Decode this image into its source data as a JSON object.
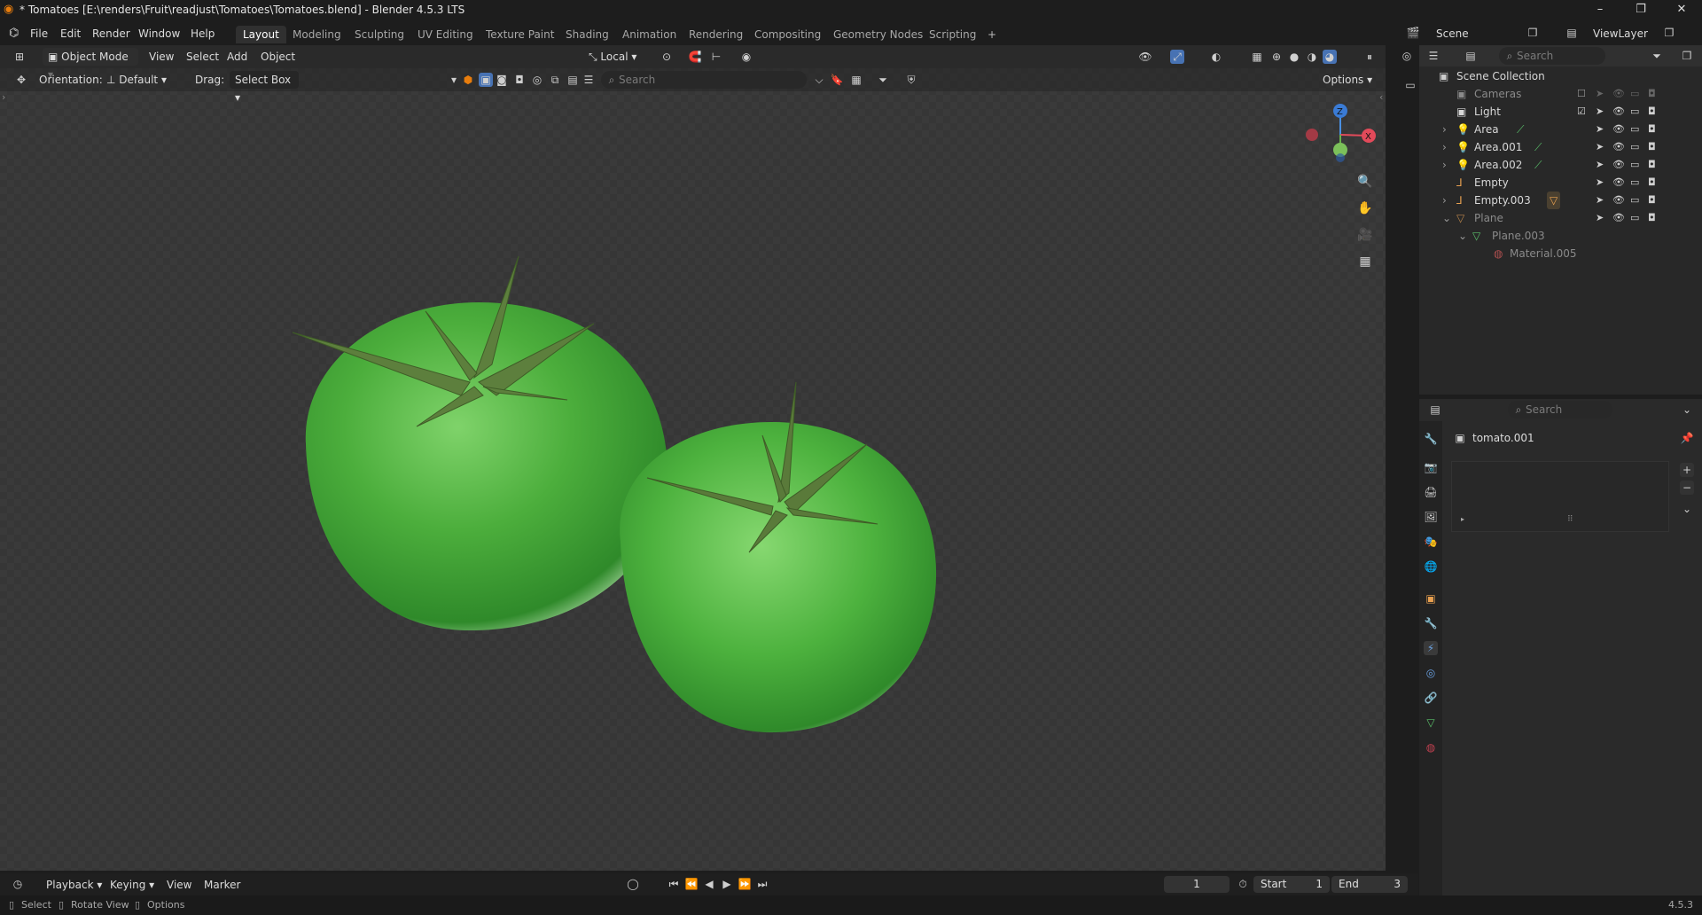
{
  "window": {
    "title": "* Tomatoes [E:\\renders\\Fruit\\readjust\\Tomatoes\\Tomatoes.blend] - Blender 4.5.3 LTS",
    "minimize": "–",
    "maximize": "❐",
    "close": "✕"
  },
  "menu": [
    "File",
    "Edit",
    "Render",
    "Window",
    "Help"
  ],
  "workspaces": [
    "Layout",
    "Modeling",
    "Sculpting",
    "UV Editing",
    "Texture Paint",
    "Shading",
    "Animation",
    "Rendering",
    "Compositing",
    "Geometry Nodes",
    "Scripting"
  ],
  "active_workspace": "Layout",
  "add_workspace": "+",
  "scene": {
    "label": "Scene",
    "viewlayer": "ViewLayer"
  },
  "viewport_header": {
    "mode": "Object Mode",
    "menus": [
      "View",
      "Select",
      "Add",
      "Object"
    ],
    "transform_space": "Local",
    "options": "Options"
  },
  "tool_settings": {
    "orientation_label": "Orientation:",
    "orientation_value": "Default",
    "drag_label": "Drag:",
    "drag_value": "Select Box",
    "search_placeholder": "Search"
  },
  "gizmo": {
    "z": "Z",
    "x": "X",
    "y": "Y"
  },
  "outliner": {
    "search_placeholder": "Search",
    "root": "Scene Collection",
    "rows": [
      {
        "name": "Cameras",
        "dim": true
      },
      {
        "name": "Light",
        "dim": false
      },
      {
        "name": "Area",
        "dim": false
      },
      {
        "name": "Area.001",
        "dim": false
      },
      {
        "name": "Area.002",
        "dim": false
      },
      {
        "name": "Empty",
        "dim": false
      },
      {
        "name": "Empty.003",
        "dim": false
      },
      {
        "name": "Plane",
        "dim": true
      },
      {
        "name": "Plane.003",
        "dim": true
      },
      {
        "name": "Material.005",
        "dim": true
      }
    ]
  },
  "properties": {
    "search_placeholder": "Search",
    "object_name": "tomato.001"
  },
  "timeline": {
    "menus": [
      "Playback",
      "Keying",
      "View",
      "Marker"
    ],
    "current_frame": "1",
    "start_label": "Start",
    "start_value": "1",
    "end_label": "End",
    "end_value": "3"
  },
  "statusbar": {
    "hints": [
      "Select",
      "Rotate View",
      "Options"
    ],
    "version": "4.5.3"
  },
  "colors": {
    "tomato_green": "#3fa83a",
    "stem_green": "#5a7a3a",
    "active_blue": "#4772b3"
  }
}
